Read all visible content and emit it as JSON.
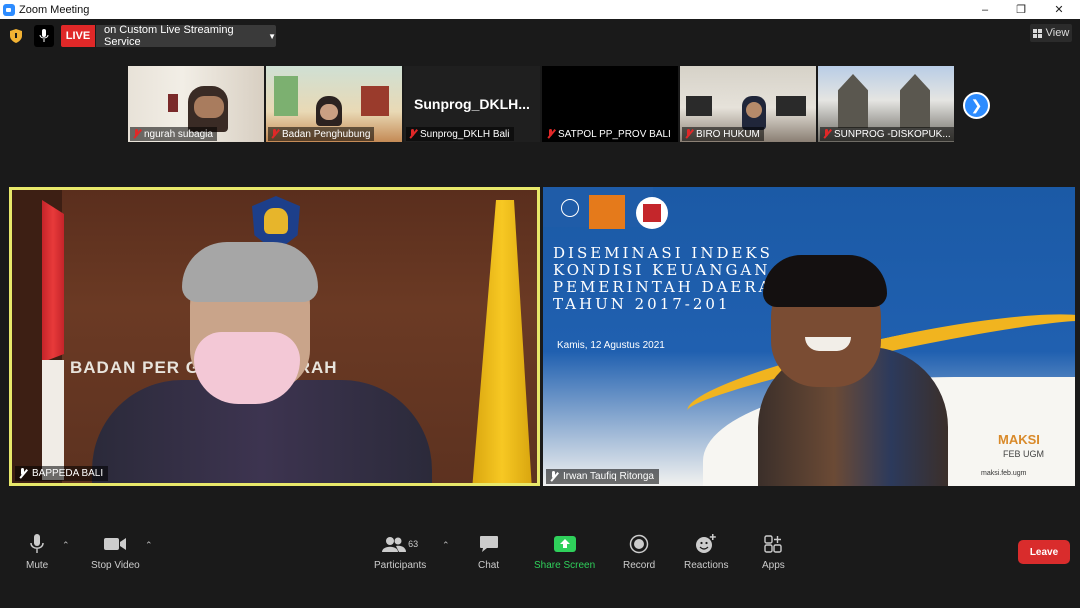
{
  "window": {
    "title": "Zoom Meeting"
  },
  "topbar": {
    "live_label": "LIVE",
    "live_service": "on Custom Live Streaming Service",
    "view_label": "View"
  },
  "thumbnails": [
    {
      "name": "ngurah subagia"
    },
    {
      "name": "Badan Penghubung"
    },
    {
      "name": "Sunprog_DKLH Bali",
      "tile_text": "Sunprog_DKLH..."
    },
    {
      "name": "SATPOL PP_PROV BALI"
    },
    {
      "name": "BIRO HUKUM"
    },
    {
      "name": "SUNPROG -DISKOPUK..."
    }
  ],
  "main_videos": {
    "left": {
      "name": "BAPPEDA BALI",
      "banner": "BADAN PER        GUNAN DAERAH"
    },
    "right": {
      "name": "Irwan Taufiq Ritonga",
      "slide_title": "DISEMINASI INDEKS\nKONDISI KEUANGAN\nPEMERINTAH DAERAH\nTAHUN 2017-201",
      "slide_date": "Kamis, 12 Agustus 2021",
      "brand": "MAKSI",
      "brand_sub": "FEB UGM",
      "social": "maksi.feb.ugm"
    }
  },
  "toolbar": {
    "mute": "Mute",
    "stop_video": "Stop Video",
    "participants": "Participants",
    "participants_count": "63",
    "chat": "Chat",
    "share_screen": "Share Screen",
    "record": "Record",
    "reactions": "Reactions",
    "apps": "Apps",
    "leave": "Leave"
  },
  "colors": {
    "accent": "#2d8cff",
    "live_red": "#e02828",
    "share_green": "#2fd05b",
    "leave_red": "#d92c2c",
    "speaker_border": "#e8e86a"
  }
}
